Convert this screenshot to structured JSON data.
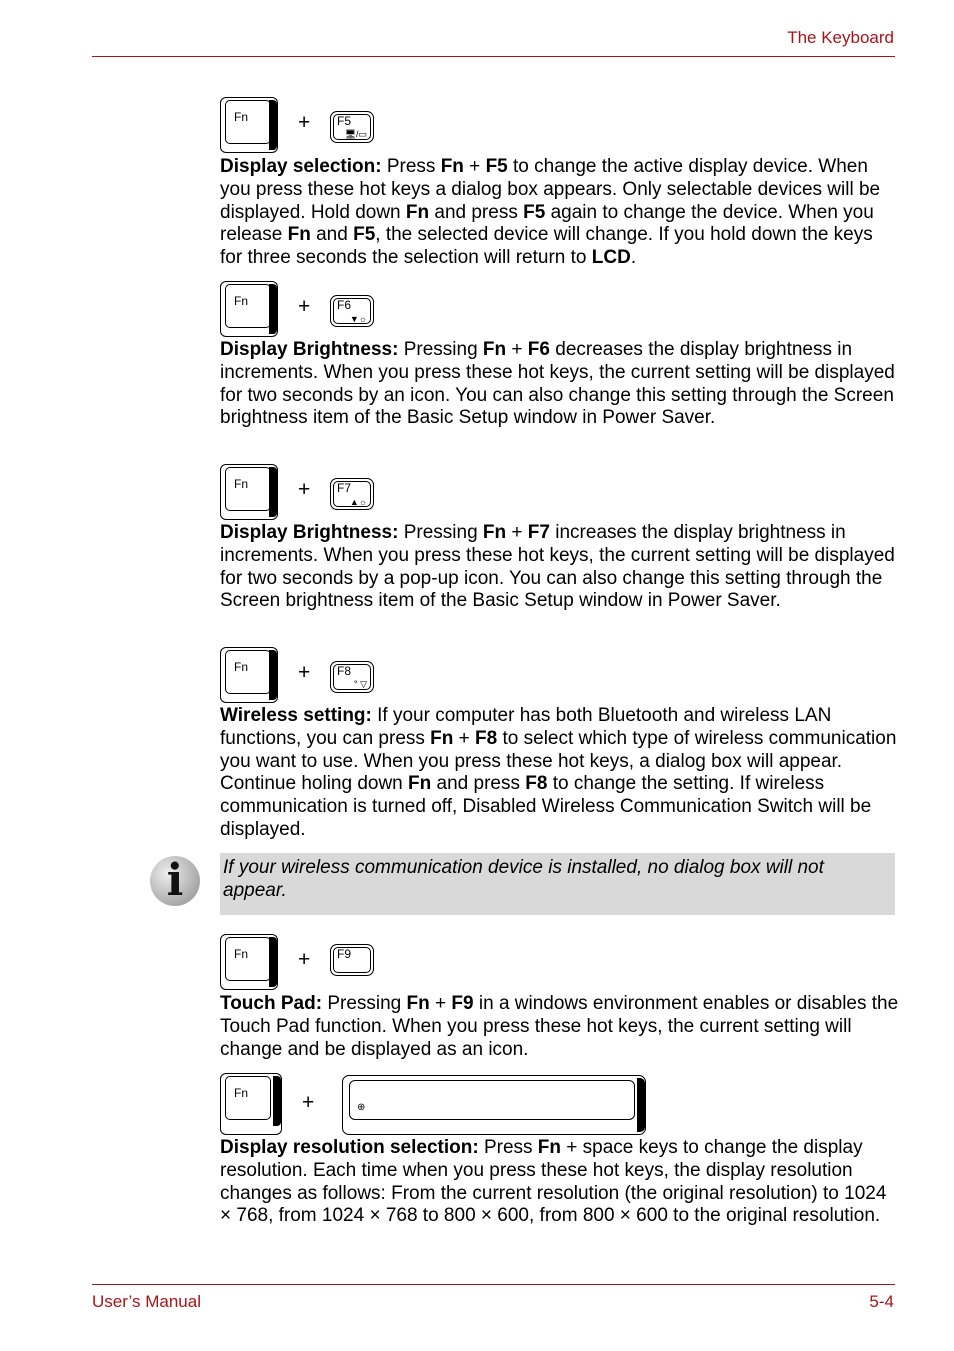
{
  "header": {
    "title": "The Keyboard"
  },
  "footer": {
    "left": "User’s Manual",
    "right": "5-4"
  },
  "keys": {
    "fn": "Fn",
    "plus": "+"
  },
  "sections": [
    {
      "fkey": "F5",
      "glyph": "🖥/▭",
      "title": "Display selection:",
      "parts": [
        " Press ",
        "Fn",
        " + ",
        "F5",
        " to change the active display device. When you press these hot keys a dialog box appears. Only selectable devices will be displayed. Hold down ",
        "Fn",
        " and press ",
        "F5",
        " again to change the device. When you release ",
        "Fn",
        " and ",
        "F5",
        ", the selected device will change. If you hold down the keys for three seconds the selection will return to ",
        "LCD",
        "."
      ]
    },
    {
      "fkey": "F6",
      "glyph": "▼☼",
      "title": "Display Brightness:",
      "parts": [
        " Pressing ",
        "Fn",
        " + ",
        "F6",
        " decreases the display brightness in increments. When you press these hot keys, the current setting will be displayed for two seconds by an icon. You can also change this setting through the Screen brightness item of the Basic Setup window in Power Saver."
      ]
    },
    {
      "fkey": "F7",
      "glyph": "▲☼",
      "title": "Display Brightness:",
      "parts": [
        " Pressing ",
        "Fn",
        " + ",
        "F7",
        " increases the display brightness in increments. When you press these hot keys, the current setting will be displayed for two seconds by a pop-up icon. You can also change this setting through the Screen brightness item of the Basic Setup window in Power Saver."
      ]
    },
    {
      "fkey": "F8",
      "glyph": "° ▽",
      "title": "Wireless setting:",
      "parts": [
        " If your computer has both Bluetooth and wireless LAN functions, you can press ",
        "Fn",
        " + ",
        "F8",
        " to select which type of wireless communication you want to use. When you press these hot keys, a dialog box will appear. Continue holing down ",
        "Fn",
        " and press ",
        "F8",
        " to change the setting. If wireless communication is turned off, Disabled Wireless Communication Switch will be displayed."
      ]
    },
    {
      "fkey": "F9",
      "glyph": "",
      "title": "Touch Pad:",
      "parts": [
        " Pressing ",
        "Fn",
        " + ",
        "F9",
        " in a windows environment enables or disables the Touch Pad function. When you press these hot keys, the current setting will change and be displayed as an icon."
      ]
    },
    {
      "fkey": "",
      "glyph": "⊕",
      "title": "Display resolution selection:",
      "parts": [
        " Press ",
        "Fn",
        " + space keys to change the display resolution. Each time when you press these hot keys, the display resolution changes as follows: From the current resolution (the original resolution) to 1024 × 768, from 1024 × 768 to 800 × 600, from 800 × 600 to the original resolution."
      ]
    }
  ],
  "note": {
    "icon": "info-icon",
    "text": "If your wireless communication device is installed, no dialog box will not appear."
  }
}
